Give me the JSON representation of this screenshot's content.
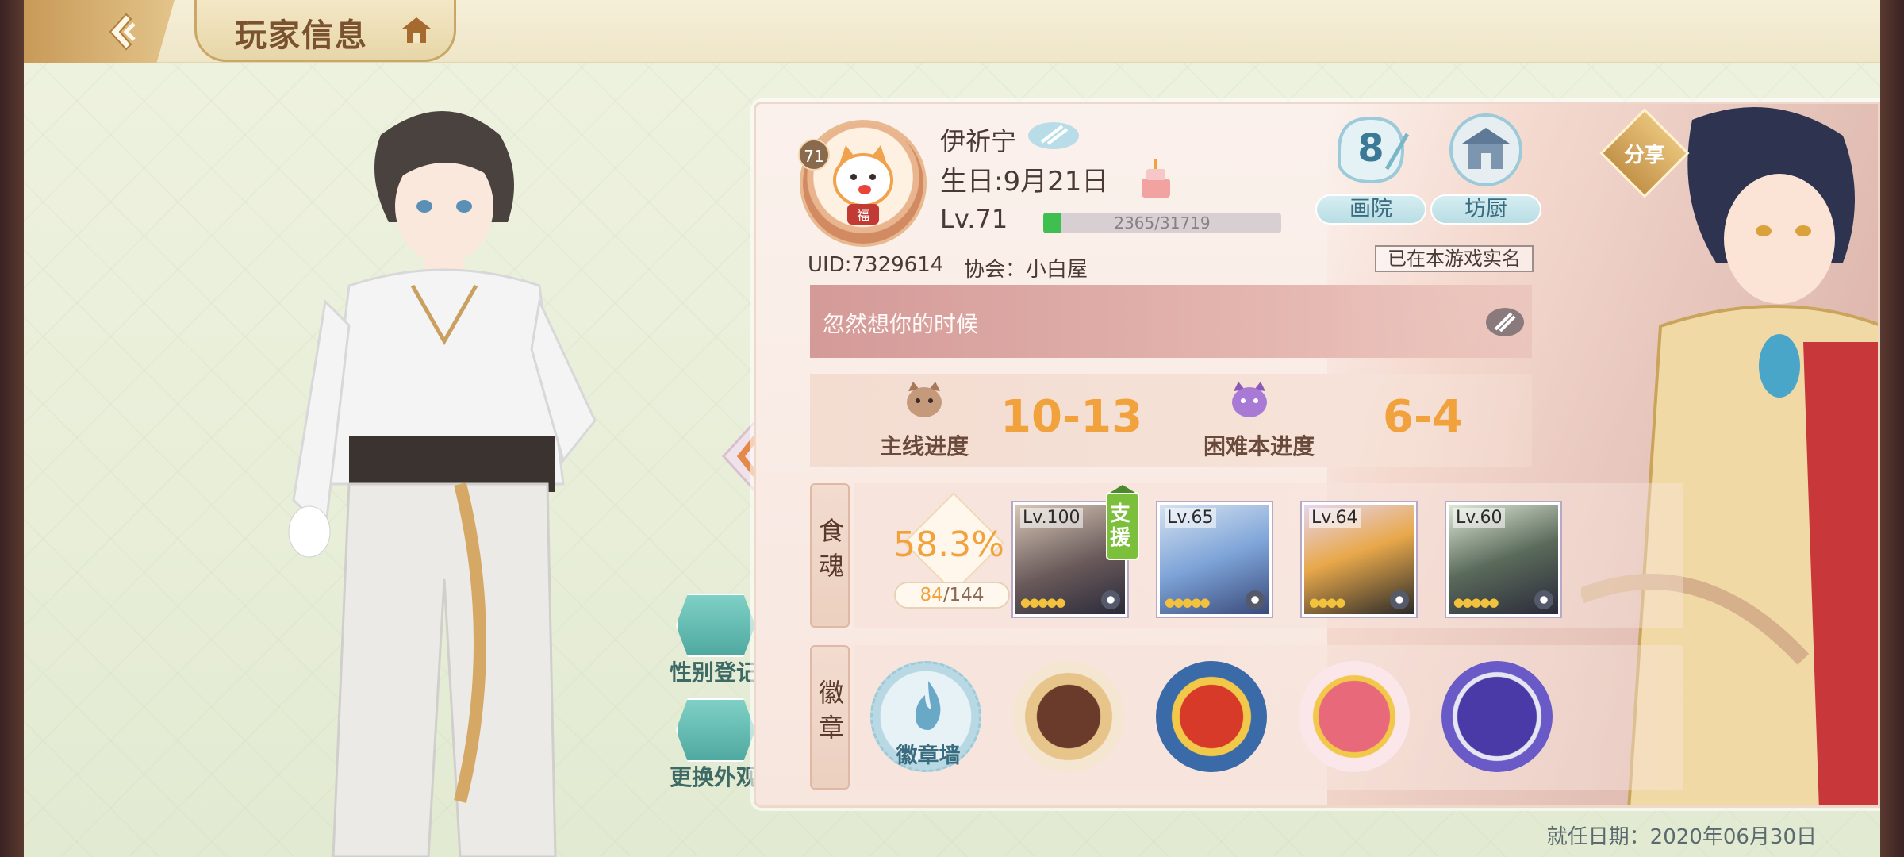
{
  "header": {
    "title": "玩家信息"
  },
  "profile": {
    "name": "伊祈宁",
    "birthday": "生日:9月21日",
    "level_label": "Lv.71",
    "avatar_level": "71",
    "exp_text": "2365/31719",
    "exp_progress": 0.0746,
    "uid": "UID:7329614",
    "guild": "协会：小白屋",
    "signature": "忽然想你的时候",
    "realname_status": "已在本游戏实名"
  },
  "features": {
    "gallery_count": "8",
    "gallery_label": "画院",
    "kitchen_label": "坊厨",
    "share_label": "分享"
  },
  "progress": {
    "main_label": "主线进度",
    "main_value": "10-13",
    "hard_label": "困难本进度",
    "hard_value": "6-4"
  },
  "soul": {
    "tag": "食魂",
    "rate": "58.3%",
    "owned": "84",
    "total": "/144",
    "support_label": "支援",
    "cards": [
      {
        "level": "Lv.100",
        "stars": "●●●●●"
      },
      {
        "level": "Lv.65",
        "stars": "●●●●●"
      },
      {
        "level": "Lv.64",
        "stars": "●●●●"
      },
      {
        "level": "Lv.60",
        "stars": "●●●●●"
      }
    ]
  },
  "badges": {
    "tag": "徽章",
    "wall_label": "徽章墙"
  },
  "side": {
    "gender_label": "性别登记",
    "outfit_label": "更换外观"
  },
  "footer": {
    "date": "就任日期：2020年06月30日"
  },
  "colors": {
    "accent_orange": "#f2a23c",
    "exp_green": "#3fbf4f",
    "teal_button": "#4fa9a0",
    "gold": "#c89a58"
  }
}
